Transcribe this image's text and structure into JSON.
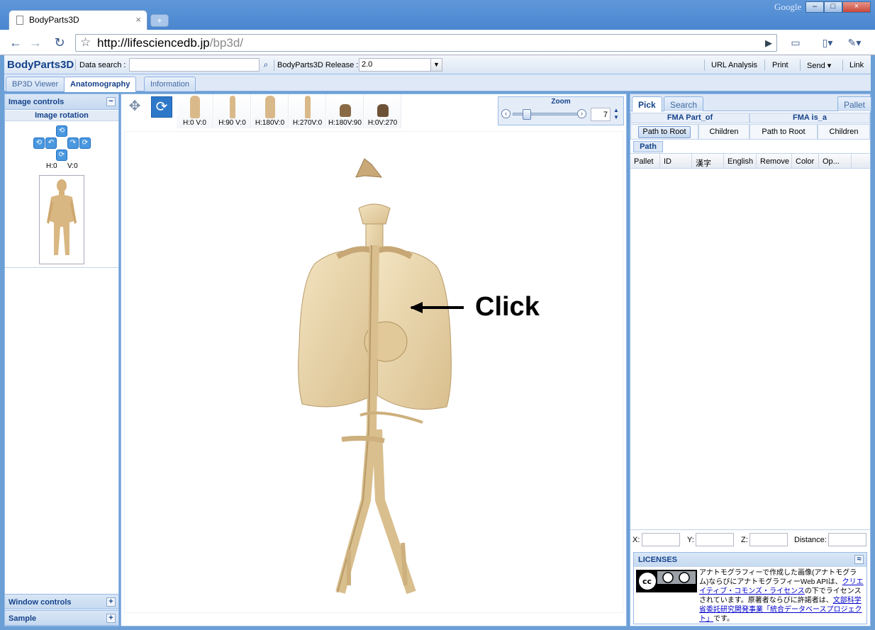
{
  "browser": {
    "tab_title": "BodyParts3D",
    "new_tab": "+",
    "brand": "Google",
    "url_host": "http://lifesciencedb.jp",
    "url_path": "/bp3d/"
  },
  "header": {
    "app_title": "BodyParts3D",
    "search_label": "Data search :",
    "search_value": "",
    "release_label": "BodyParts3D Release :",
    "release_value": "2.0",
    "actions": [
      "URL Analysis",
      "Print",
      "Send",
      "Link"
    ]
  },
  "tabs": [
    "BP3D Viewer",
    "Anatomography",
    "Information"
  ],
  "left_panel": {
    "image_controls": "Image controls",
    "image_rotation": "Image rotation",
    "angle_h": "H:0",
    "angle_v": "V:0",
    "window_controls": "Window controls",
    "sample": "Sample"
  },
  "viewer": {
    "poses": [
      "H:0 V:0",
      "H:90 V:0",
      "H:180V:0",
      "H:270V:0",
      "H:180V:90",
      "H:0V:270"
    ],
    "zoom_label": "Zoom",
    "zoom_value": "7",
    "annotation": "Click"
  },
  "right_panel": {
    "tabs": [
      "Pick",
      "Search"
    ],
    "pallet_button": "Pallet",
    "fma_part_of": "FMA Part_of",
    "fma_is_a": "FMA is_a",
    "buttons": [
      "Path to Root",
      "Children",
      "Path to Root",
      "Children"
    ],
    "path_tab": "Path",
    "columns": [
      "Pallet",
      "ID",
      "漢字",
      "English",
      "Remove",
      "Color",
      "Op..."
    ],
    "coords": {
      "x": "X:",
      "y": "Y:",
      "z": "Z:",
      "distance": "Distance:"
    },
    "licenses": {
      "title": "LICENSES",
      "text1": "アナトモグラフィーで作成した画像(アナトモグラム)ならびにアナトモグラフィーWeb APIは、",
      "link1": "クリエイティブ・コモンズ・ライセンス",
      "text2": "の下でライセンスされています。原著者ならびに許諾者は、",
      "link2": "文部科学省委託研究開発事業「統合データベースプロジェクト」",
      "text3": "です。"
    }
  },
  "colors": {
    "accent": "#15428b",
    "panel_border": "#99bbe8",
    "organ": "#e9d8b0"
  }
}
